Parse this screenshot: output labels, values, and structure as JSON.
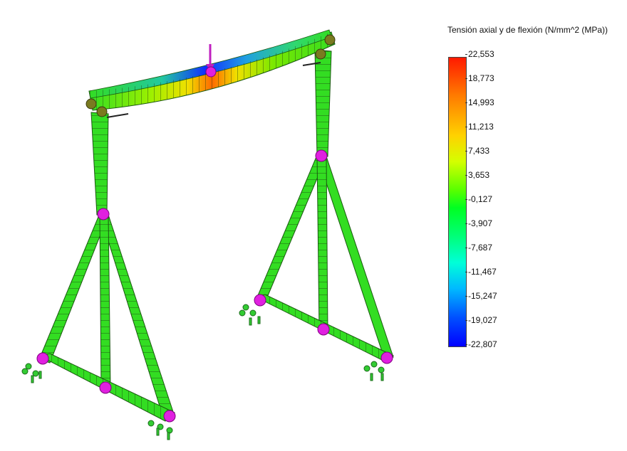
{
  "legend": {
    "title": "Tensión axial y de flexión (N/mm^2 (MPa))",
    "ticks": [
      "22,553",
      "18,773",
      "14,993",
      "11,213",
      "7,433",
      "3,653",
      "-0,127",
      "-3,907",
      "-7,687",
      "-11,467",
      "-15,247",
      "-19,027",
      "-22,807"
    ]
  },
  "colors": {
    "member": "#33dd22",
    "member_dark": "#229918",
    "joint": "#e020e0",
    "fixture": "#33cc33",
    "bearing": "#7a7a20",
    "load_arrow": "#c020c0"
  }
}
